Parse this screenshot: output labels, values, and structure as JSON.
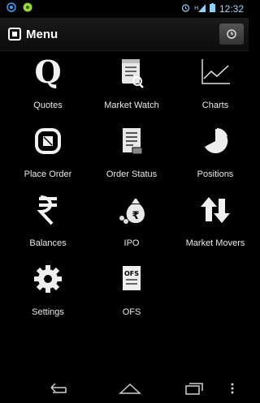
{
  "status_bar": {
    "time": "12:32"
  },
  "header": {
    "title": "Menu"
  },
  "menu": [
    {
      "label": "Quotes",
      "icon": "quotes-icon"
    },
    {
      "label": "Market Watch",
      "icon": "market-watch-icon"
    },
    {
      "label": "Charts",
      "icon": "charts-icon"
    },
    {
      "label": "Place Order",
      "icon": "place-order-icon"
    },
    {
      "label": "Order Status",
      "icon": "order-status-icon"
    },
    {
      "label": "Positions",
      "icon": "positions-icon"
    },
    {
      "label": "Balances",
      "icon": "rupee-icon"
    },
    {
      "label": "IPO",
      "icon": "money-bag-icon"
    },
    {
      "label": "Market Movers",
      "icon": "up-down-arrows-icon"
    },
    {
      "label": "Settings",
      "icon": "gear-icon"
    },
    {
      "label": "OFS",
      "icon": "ofs-icon",
      "icon_text": "OFS"
    }
  ]
}
